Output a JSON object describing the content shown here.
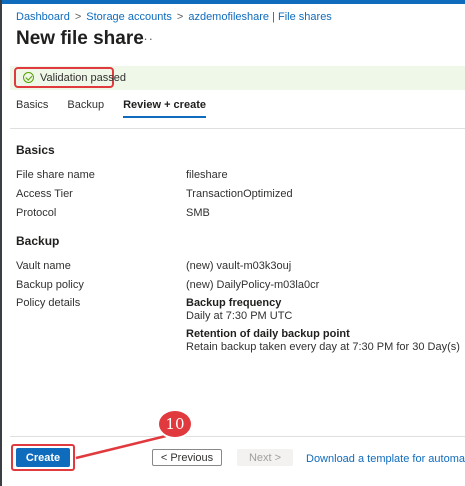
{
  "breadcrumb": {
    "items": [
      "Dashboard",
      "Storage accounts",
      "azdemofileshare | File shares"
    ],
    "separator": ">"
  },
  "page": {
    "title": "New file share",
    "more_icon": "ellipsis-icon",
    "more_glyph": "···"
  },
  "validation": {
    "icon": "check-circle-icon",
    "text": "Validation passed",
    "color": "#57a300"
  },
  "tabs": [
    {
      "label": "Basics",
      "active": false
    },
    {
      "label": "Backup",
      "active": false
    },
    {
      "label": "Review + create",
      "active": true
    }
  ],
  "basics": {
    "heading": "Basics",
    "rows": [
      {
        "label": "File share name",
        "value": "fileshare"
      },
      {
        "label": "Access Tier",
        "value": "TransactionOptimized"
      },
      {
        "label": "Protocol",
        "value": "SMB"
      }
    ]
  },
  "backup": {
    "heading": "Backup",
    "rows": [
      {
        "label": "Vault name",
        "value": "(new) vault-m03k3ouj"
      },
      {
        "label": "Backup policy",
        "value": "(new) DailyPolicy-m03la0cr"
      }
    ],
    "policy_details": {
      "label": "Policy details",
      "frequency_title": "Backup frequency",
      "frequency_value": "Daily at 7:30 PM UTC",
      "retention_title": "Retention of daily backup point",
      "retention_value": "Retain backup taken every day at 7:30 PM for 30 Day(s)"
    }
  },
  "footer": {
    "create_label": "Create",
    "previous_label": "< Previous",
    "next_label": "Next >",
    "download_link": "Download a template for automation"
  },
  "annotation": {
    "step_number": "10",
    "color": "#e03a3e"
  }
}
